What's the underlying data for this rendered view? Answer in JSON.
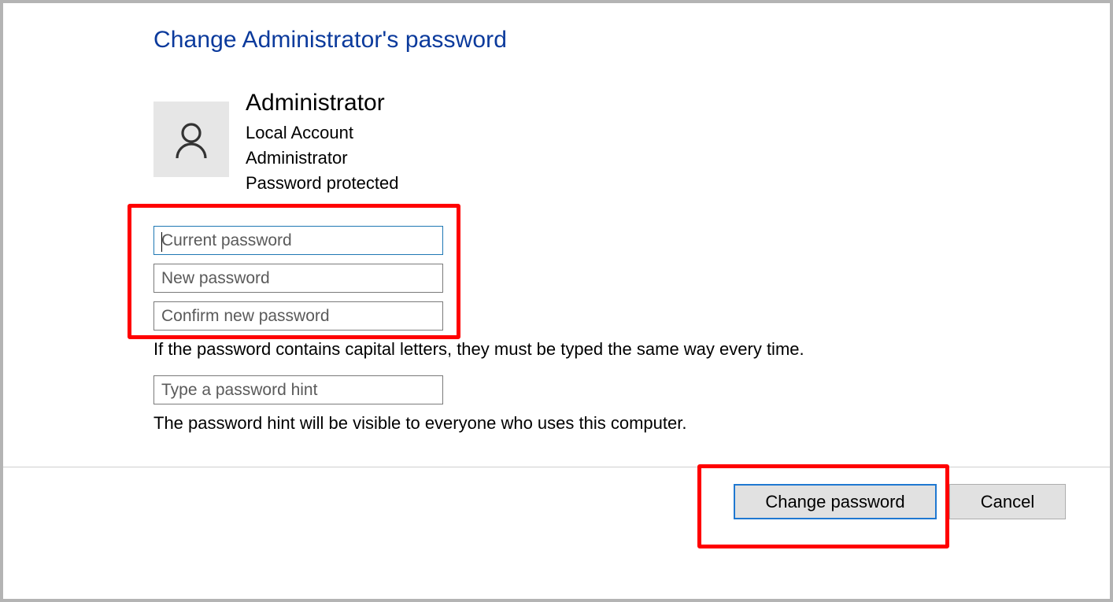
{
  "dialog": {
    "title": "Change Administrator's password"
  },
  "account": {
    "avatar_icon": "user-icon",
    "name": "Administrator",
    "type": "Local Account",
    "role": "Administrator",
    "status": "Password protected"
  },
  "form": {
    "current_password": {
      "placeholder": "Current password",
      "value": ""
    },
    "new_password": {
      "placeholder": "New password",
      "value": ""
    },
    "confirm_password": {
      "placeholder": "Confirm new password",
      "value": ""
    },
    "caps_note": "If the password contains capital letters, they must be typed the same way every time.",
    "hint": {
      "placeholder": "Type a password hint",
      "value": ""
    },
    "hint_note": "The password hint will be visible to everyone who uses this computer."
  },
  "buttons": {
    "change_password": "Change password",
    "cancel": "Cancel"
  },
  "annotations": {
    "color": "#ff0000"
  },
  "colors": {
    "title": "#0b3a9c",
    "focus_border": "#1f78b4",
    "button_bg": "#e1e1e1"
  }
}
